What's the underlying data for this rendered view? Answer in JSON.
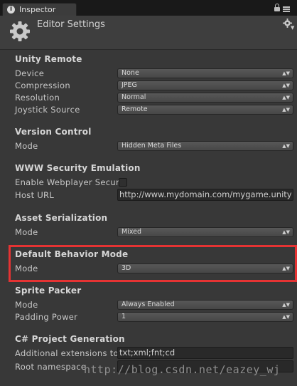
{
  "tab": {
    "label": "Inspector",
    "icon": "info-icon"
  },
  "header": {
    "title": "Editor Settings",
    "icon": "gear-icon"
  },
  "sections": {
    "unity_remote": {
      "title": "Unity Remote",
      "device_label": "Device",
      "device_value": "None",
      "compression_label": "Compression",
      "compression_value": "JPEG",
      "resolution_label": "Resolution",
      "resolution_value": "Normal",
      "joystick_label": "Joystick Source",
      "joystick_value": "Remote"
    },
    "version_control": {
      "title": "Version Control",
      "mode_label": "Mode",
      "mode_value": "Hidden Meta Files"
    },
    "www_security": {
      "title": "WWW Security Emulation",
      "enable_label": "Enable Webplayer Securi",
      "enable_checked": false,
      "host_label": "Host URL",
      "host_value": "http://www.mydomain.com/mygame.unity"
    },
    "asset_serialization": {
      "title": "Asset Serialization",
      "mode_label": "Mode",
      "mode_value": "Mixed"
    },
    "default_behavior": {
      "title": "Default Behavior Mode",
      "mode_label": "Mode",
      "mode_value": "3D",
      "highlight_color": "#e53333"
    },
    "sprite_packer": {
      "title": "Sprite Packer",
      "mode_label": "Mode",
      "mode_value": "Always Enabled",
      "padding_label": "Padding Power",
      "padding_value": "1"
    },
    "csharp_project": {
      "title": "C# Project Generation",
      "extensions_label": "Additional extensions to i",
      "extensions_value": "txt;xml;fnt;cd",
      "namespace_label": "Root namespace",
      "namespace_value": ""
    }
  },
  "watermark": "http://blog.csdn.net/eazey_wj",
  "colors": {
    "background": "#383838",
    "tabbar": "#191919",
    "accent_red": "#e53333"
  }
}
